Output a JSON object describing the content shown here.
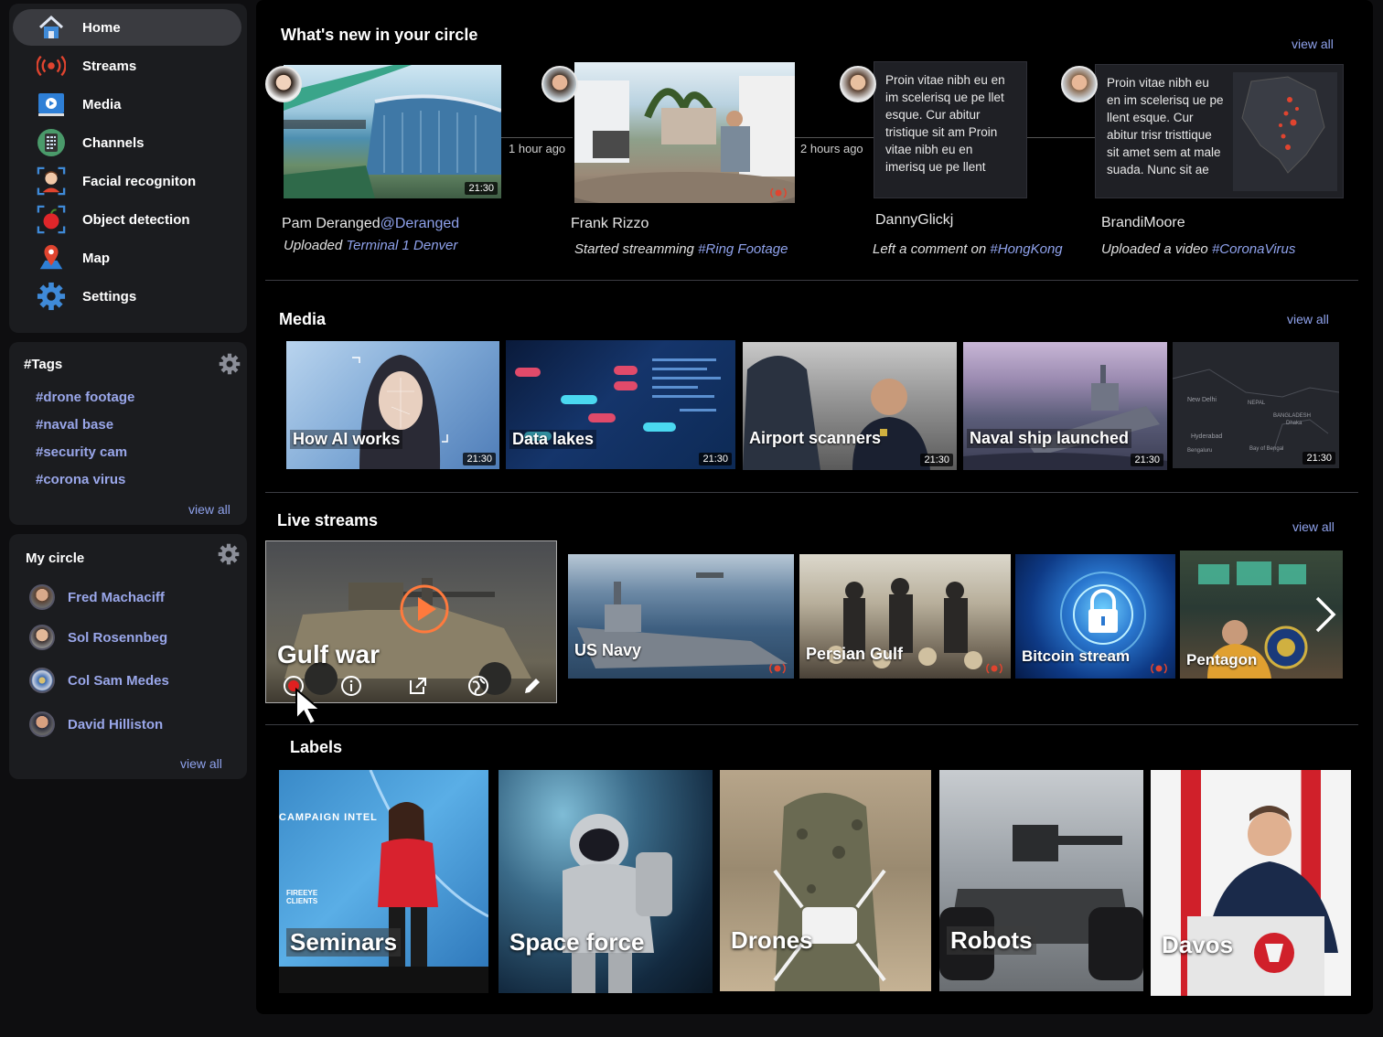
{
  "nav": {
    "items": [
      {
        "label": "Home",
        "icon": "home-icon"
      },
      {
        "label": "Streams",
        "icon": "broadcast-icon"
      },
      {
        "label": "Media",
        "icon": "media-icon"
      },
      {
        "label": "Channels",
        "icon": "channels-icon"
      },
      {
        "label": "Facial recogniton",
        "icon": "face-scan-icon"
      },
      {
        "label": "Object detection",
        "icon": "object-scan-icon"
      },
      {
        "label": "Map",
        "icon": "map-pin-icon"
      },
      {
        "label": "Settings",
        "icon": "gear-icon"
      }
    ]
  },
  "tags": {
    "title": "#Tags",
    "items": [
      "#drone footage",
      "#naval base",
      "#security cam",
      "#corona virus"
    ],
    "view_all": "view all"
  },
  "circle": {
    "title": "My circle",
    "people": [
      "Fred Machaciff",
      "Sol Rosennbeg",
      "Col Sam Medes",
      "David Hilliston"
    ],
    "view_all": "view all"
  },
  "activity": {
    "title": "What's new in your circle",
    "view_all": "view all",
    "items": [
      {
        "name": "Pam Deranged",
        "handle": "@Deranged",
        "action": "Uploaded",
        "target": "Terminal 1 Denver",
        "duration": "21:30"
      },
      {
        "name": "Frank Rizzo",
        "action": "Started streamming",
        "target": "#Ring Footage",
        "time": "1 hour ago"
      },
      {
        "name": "DannyGlickj",
        "action": "Left a comment on",
        "target": "#HongKong",
        "time": "2 hours ago",
        "comment": "Proin vitae nibh eu en im scelerisq ue pe llet esque. Cur abitur tristique sit am Proin vitae nibh eu en imerisq ue pe llent"
      },
      {
        "name": "BrandiMoore",
        "action": "Uploaded a video",
        "target": "#CoronaVirus",
        "comment": "Proin vitae nibh eu en im scelerisq ue pe llent esque. Cur abitur trisr tristtique sit amet sem at male suada. Nunc sit ae"
      }
    ]
  },
  "media": {
    "title": "Media",
    "view_all": "view all",
    "items": [
      {
        "title": "How AI works",
        "duration": "21:30"
      },
      {
        "title": "Data lakes",
        "duration": "21:30"
      },
      {
        "title": "Airport scanners",
        "duration": "21:30"
      },
      {
        "title": "Naval ship launched",
        "duration": "21:30"
      },
      {
        "title": "",
        "duration": "21:30"
      }
    ]
  },
  "live": {
    "title": "Live streams",
    "view_all": "view all",
    "featured": {
      "title": "Gulf war"
    },
    "items": [
      "US Navy",
      "Persian Gulf",
      "Bitcoin stream",
      "Pentagon"
    ]
  },
  "labels": {
    "title": "Labels",
    "items": [
      "Seminars",
      "Space force",
      "Drones",
      "Robots",
      "Davos"
    ],
    "seminar_banner": "CAMPAIGN INTEL",
    "seminar_sub": "FIREEYE CLIENTS"
  },
  "map_labels": {
    "new_delhi": "New Delhi",
    "nepal": "NEPAL",
    "hyderabad": "Hyderabad",
    "bangladesh": "BANGLADESH",
    "dhaka": "Dhaka",
    "bengaluru": "Bengaluru",
    "bay": "Bay of Bengal"
  },
  "colors": {
    "accent": "#8fa2ec",
    "panel": "#1b1c1f",
    "live_red": "#e0442f",
    "play_orange": "#ff7a3d"
  }
}
